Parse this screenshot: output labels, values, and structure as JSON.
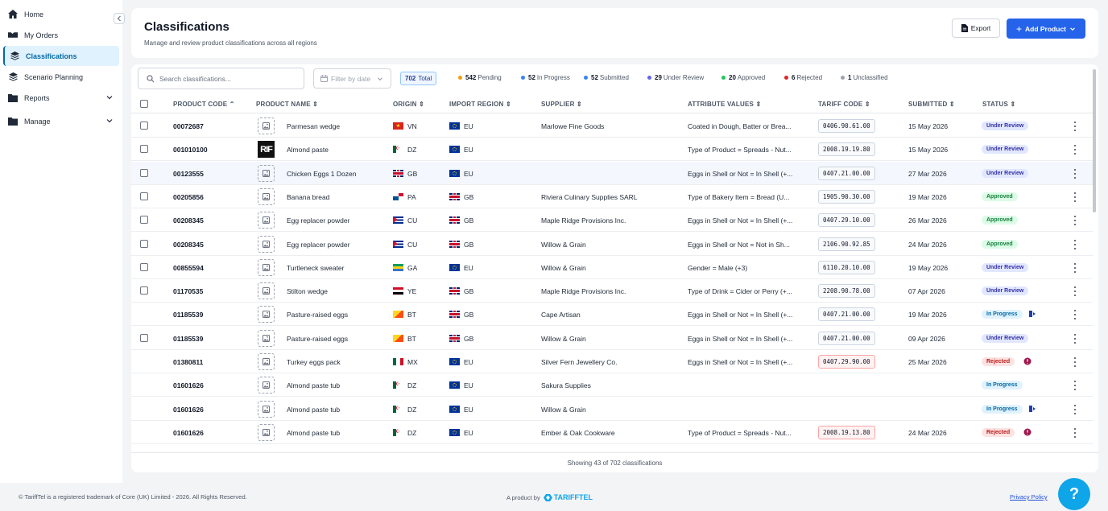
{
  "sidebar": {
    "items": [
      {
        "label": "Home",
        "icon": "home-icon"
      },
      {
        "label": "My Orders",
        "icon": "orders-icon"
      },
      {
        "label": "Classifications",
        "icon": "layers-icon",
        "active": true
      },
      {
        "label": "Scenario Planning",
        "icon": "layers-icon"
      },
      {
        "label": "Reports",
        "icon": "folder-icon",
        "expandable": true
      },
      {
        "label": "Manage",
        "icon": "folder-icon",
        "expandable": true
      }
    ]
  },
  "header": {
    "title": "Classifications",
    "subtitle": "Manage and review product classifications across all regions",
    "export_label": "Export",
    "add_label": "Add Product"
  },
  "toolbar": {
    "search_placeholder": "Search classifications...",
    "filter_label": "Filter by date",
    "total_count": "702",
    "total_label": "Total",
    "stats": [
      {
        "count": "542",
        "label": "Pending",
        "color": "#f59e0b"
      },
      {
        "count": "52",
        "label": "In Progress",
        "color": "#3b82f6"
      },
      {
        "count": "52",
        "label": "Submitted",
        "color": "#3b82f6"
      },
      {
        "count": "29",
        "label": "Under Review",
        "color": "#6366f1"
      },
      {
        "count": "20",
        "label": "Approved",
        "color": "#22c55e"
      },
      {
        "count": "6",
        "label": "Rejected",
        "color": "#dc2626"
      },
      {
        "count": "1",
        "label": "Unclassified",
        "color": "#9ca3af"
      }
    ]
  },
  "table": {
    "columns": {
      "code": "PRODUCT CODE",
      "name": "PRODUCT NAME",
      "origin": "ORIGIN",
      "import_region": "IMPORT REGION",
      "supplier": "SUPPLIER",
      "attributes": "ATTRIBUTE VALUES",
      "tariff": "TARIFF CODE",
      "submitted": "SUBMITTED",
      "status": "STATUS"
    },
    "rows": [
      {
        "code": "00072687",
        "name": "Parmesan wedge",
        "origin": "VN",
        "region": "EU",
        "supplier": "Marlowe Fine Goods",
        "attributes": "Coated in Dough, Batter or Brea...",
        "tariff": "0406.90.61.00",
        "submitted": "15 May 2026",
        "status": "Under Review"
      },
      {
        "code": "001010100",
        "name": "Almond paste",
        "origin": "DZ",
        "region": "EU",
        "supplier": "",
        "attributes": "Type of Product = Spreads - Nut...",
        "tariff": "2008.19.19.80",
        "submitted": "15 May 2026",
        "status": "Under Review",
        "thumb_text": "RIF"
      },
      {
        "code": "00123555",
        "name": "Chicken Eggs 1 Dozen",
        "origin": "GB",
        "region": "EU",
        "supplier": "",
        "attributes": "Eggs in Shell or Not = In Shell (+...",
        "tariff": "0407.21.00.00",
        "submitted": "27 Mar 2026",
        "status": "Under Review"
      },
      {
        "code": "00205856",
        "name": "Banana bread",
        "origin": "PA",
        "region": "GB",
        "supplier": "Riviera Culinary Supplies SARL",
        "attributes": "Type of Bakery Item = Bread (U...",
        "tariff": "1905.90.30.00",
        "submitted": "19 Mar 2026",
        "status": "Approved"
      },
      {
        "code": "00208345",
        "name": "Egg replacer powder",
        "origin": "CU",
        "region": "GB",
        "supplier": "Maple Ridge Provisions Inc.",
        "attributes": "Eggs in Shell or Not = In Shell (+...",
        "tariff": "0407.29.10.00",
        "submitted": "26 Mar 2026",
        "status": "Approved"
      },
      {
        "code": "00208345",
        "name": "Egg replacer powder",
        "origin": "CU",
        "region": "GB",
        "supplier": "Willow & Grain",
        "attributes": "Eggs in Shell or Not = Not in Sh...",
        "tariff": "2106.90.92.85",
        "submitted": "24 Mar 2026",
        "status": "Approved"
      },
      {
        "code": "00855594",
        "name": "Turtleneck sweater",
        "origin": "GA",
        "region": "EU",
        "supplier": "Willow & Grain",
        "attributes": "Gender = Male (+3)",
        "tariff": "6110.20.10.00",
        "submitted": "19 May 2026",
        "status": "Under Review"
      },
      {
        "code": "01170535",
        "name": "Stilton wedge",
        "origin": "YE",
        "region": "GB",
        "supplier": "Maple Ridge Provisions Inc.",
        "attributes": "Type of Drink = Cider or Perry (+...",
        "tariff": "2208.90.78.00",
        "submitted": "07 Apr 2026",
        "status": "Under Review"
      },
      {
        "code": "01185539",
        "name": "Pasture-raised eggs",
        "origin": "BT",
        "region": "GB",
        "supplier": "Cape Artisan",
        "attributes": "Eggs in Shell or Not = In Shell (+...",
        "tariff": "0407.21.00.00",
        "submitted": "19 Mar 2026",
        "status": "In Progress"
      },
      {
        "code": "01185539",
        "name": "Pasture-raised eggs",
        "origin": "BT",
        "region": "GB",
        "supplier": "Willow & Grain",
        "attributes": "Eggs in Shell or Not = In Shell (+...",
        "tariff": "0407.21.00.00",
        "submitted": "09 Apr 2026",
        "status": "Under Review"
      },
      {
        "code": "01380811",
        "name": "Turkey eggs pack",
        "origin": "MX",
        "region": "EU",
        "supplier": "Silver Fern Jewellery Co.",
        "attributes": "Eggs in Shell or Not = In Shell (+...",
        "tariff": "0407.29.90.00",
        "submitted": "25 Mar 2026",
        "status": "Rejected"
      },
      {
        "code": "01601626",
        "name": "Almond paste tub",
        "origin": "DZ",
        "region": "EU",
        "supplier": "Sakura Supplies",
        "attributes": "",
        "tariff": "",
        "submitted": "",
        "status": "In Progress"
      },
      {
        "code": "01601626",
        "name": "Almond paste tub",
        "origin": "DZ",
        "region": "EU",
        "supplier": "Willow & Grain",
        "attributes": "",
        "tariff": "",
        "submitted": "",
        "status": "In Progress"
      },
      {
        "code": "01601626",
        "name": "Almond paste tub",
        "origin": "DZ",
        "region": "EU",
        "supplier": "Ember & Oak Cookware",
        "attributes": "Type of Product = Spreads - Nut...",
        "tariff": "2008.19.13.80",
        "submitted": "24 Mar 2026",
        "status": "Rejected"
      }
    ],
    "footer": "Showing 43 of 702 classifications"
  },
  "footer": {
    "copyright": "© TariffTel is a registered trademark of Core (UK) Limited - 2026. All Rights Reserved.",
    "product_by": "A product by",
    "brand": "TARIFFTEL",
    "privacy": "Privacy Policy"
  },
  "help_label": "?",
  "colors": {
    "accent": "#2563eb",
    "active_nav": "#0369a1",
    "help": "#0ea5e9"
  }
}
